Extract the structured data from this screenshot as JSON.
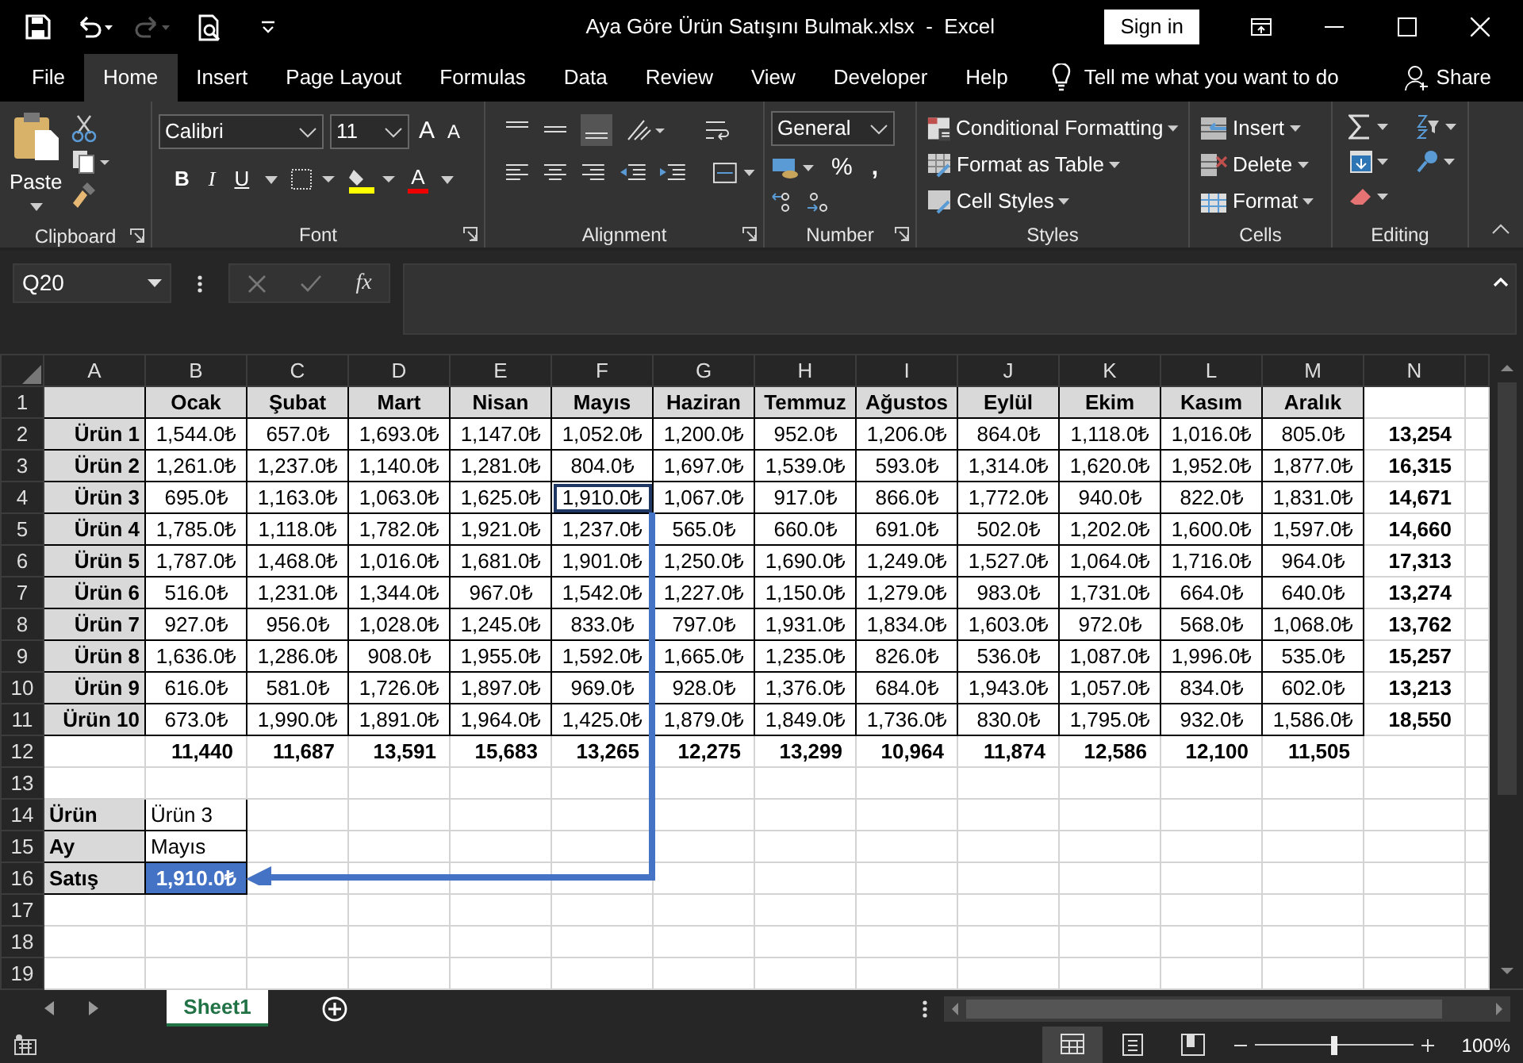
{
  "window": {
    "title": "Aya Göre Ürün Satışını Bulmak.xlsx  -  Excel",
    "sign_in": "Sign in"
  },
  "menu": [
    {
      "label": "File",
      "selected": false
    },
    {
      "label": "Home",
      "selected": true
    },
    {
      "label": "Insert",
      "selected": false
    },
    {
      "label": "Page Layout",
      "selected": false
    },
    {
      "label": "Formulas",
      "selected": false
    },
    {
      "label": "Data",
      "selected": false
    },
    {
      "label": "Review",
      "selected": false
    },
    {
      "label": "View",
      "selected": false
    },
    {
      "label": "Developer",
      "selected": false
    },
    {
      "label": "Help",
      "selected": false
    }
  ],
  "tell_me": "Tell me what you want to do",
  "share": "Share",
  "ribbon": {
    "clipboard": {
      "paste": "Paste",
      "label": "Clipboard"
    },
    "font": {
      "name": "Calibri",
      "size": "11",
      "grow": "A",
      "shrink": "A",
      "bold": "B",
      "italic": "I",
      "underline": "U",
      "font_color": "A",
      "label": "Font"
    },
    "alignment": {
      "label": "Alignment"
    },
    "number": {
      "format": "General",
      "percent": "%",
      "comma": ",",
      "label": "Number"
    },
    "styles": {
      "buttons": [
        "Conditional Formatting",
        "Format as Table",
        "Cell Styles"
      ],
      "label": "Styles"
    },
    "cells": {
      "buttons": [
        "Insert",
        "Delete",
        "Format"
      ],
      "label": "Cells"
    },
    "editing": {
      "label": "Editing"
    }
  },
  "name_box": "Q20",
  "formula_label": "fx",
  "sheet": {
    "columns": [
      "A",
      "B",
      "C",
      "D",
      "E",
      "F",
      "G",
      "H",
      "I",
      "J",
      "K",
      "L",
      "M",
      "N"
    ],
    "rows": [
      {
        "number": "1",
        "cells": [
          {
            "kind": "grey"
          },
          {
            "kind": "month",
            "text": "Ocak"
          },
          {
            "kind": "month",
            "text": "Şubat"
          },
          {
            "kind": "month",
            "text": "Mart"
          },
          {
            "kind": "month",
            "text": "Nisan"
          },
          {
            "kind": "month",
            "text": "Mayıs"
          },
          {
            "kind": "month",
            "text": "Haziran"
          },
          {
            "kind": "month",
            "text": "Temmuz"
          },
          {
            "kind": "month",
            "text": "Ağustos"
          },
          {
            "kind": "month",
            "text": "Eylül"
          },
          {
            "kind": "month",
            "text": "Ekim"
          },
          {
            "kind": "month",
            "text": "Kasım"
          },
          {
            "kind": "month",
            "text": "Aralık"
          }
        ]
      },
      {
        "number": "2",
        "cells": [
          {
            "kind": "product",
            "text": "Ürün 1"
          },
          {
            "kind": "amount",
            "text": "1,544.0₺"
          },
          {
            "kind": "amount",
            "text": "657.0₺"
          },
          {
            "kind": "amount",
            "text": "1,693.0₺"
          },
          {
            "kind": "amount",
            "text": "1,147.0₺"
          },
          {
            "kind": "amount",
            "text": "1,052.0₺"
          },
          {
            "kind": "amount",
            "text": "1,200.0₺"
          },
          {
            "kind": "amount",
            "text": "952.0₺"
          },
          {
            "kind": "amount",
            "text": "1,206.0₺"
          },
          {
            "kind": "amount",
            "text": "864.0₺"
          },
          {
            "kind": "amount",
            "text": "1,118.0₺"
          },
          {
            "kind": "amount",
            "text": "1,016.0₺"
          },
          {
            "kind": "amount",
            "text": "805.0₺"
          },
          {
            "kind": "total",
            "text": "13,254"
          }
        ]
      },
      {
        "number": "3",
        "cells": [
          {
            "kind": "product",
            "text": "Ürün 2"
          },
          {
            "kind": "amount",
            "text": "1,261.0₺"
          },
          {
            "kind": "amount",
            "text": "1,237.0₺"
          },
          {
            "kind": "amount",
            "text": "1,140.0₺"
          },
          {
            "kind": "amount",
            "text": "1,281.0₺"
          },
          {
            "kind": "amount",
            "text": "804.0₺"
          },
          {
            "kind": "amount",
            "text": "1,697.0₺"
          },
          {
            "kind": "amount",
            "text": "1,539.0₺"
          },
          {
            "kind": "amount",
            "text": "593.0₺"
          },
          {
            "kind": "amount",
            "text": "1,314.0₺"
          },
          {
            "kind": "amount",
            "text": "1,620.0₺"
          },
          {
            "kind": "amount",
            "text": "1,952.0₺"
          },
          {
            "kind": "amount",
            "text": "1,877.0₺"
          },
          {
            "kind": "total",
            "text": "16,315"
          }
        ]
      },
      {
        "number": "4",
        "cells": [
          {
            "kind": "product",
            "text": "Ürün 3"
          },
          {
            "kind": "amount",
            "text": "695.0₺"
          },
          {
            "kind": "amount",
            "text": "1,163.0₺"
          },
          {
            "kind": "amount",
            "text": "1,063.0₺"
          },
          {
            "kind": "amount",
            "text": "1,625.0₺"
          },
          {
            "kind": "highlight",
            "text": "1,910.0₺"
          },
          {
            "kind": "amount",
            "text": "1,067.0₺"
          },
          {
            "kind": "amount",
            "text": "917.0₺"
          },
          {
            "kind": "amount",
            "text": "866.0₺"
          },
          {
            "kind": "amount",
            "text": "1,772.0₺"
          },
          {
            "kind": "amount",
            "text": "940.0₺"
          },
          {
            "kind": "amount",
            "text": "822.0₺"
          },
          {
            "kind": "amount",
            "text": "1,831.0₺"
          },
          {
            "kind": "total",
            "text": "14,671"
          }
        ]
      },
      {
        "number": "5",
        "cells": [
          {
            "kind": "product",
            "text": "Ürün 4"
          },
          {
            "kind": "amount",
            "text": "1,785.0₺"
          },
          {
            "kind": "amount",
            "text": "1,118.0₺"
          },
          {
            "kind": "amount",
            "text": "1,782.0₺"
          },
          {
            "kind": "amount",
            "text": "1,921.0₺"
          },
          {
            "kind": "amount",
            "text": "1,237.0₺"
          },
          {
            "kind": "amount",
            "text": "565.0₺"
          },
          {
            "kind": "amount",
            "text": "660.0₺"
          },
          {
            "kind": "amount",
            "text": "691.0₺"
          },
          {
            "kind": "amount",
            "text": "502.0₺"
          },
          {
            "kind": "amount",
            "text": "1,202.0₺"
          },
          {
            "kind": "amount",
            "text": "1,600.0₺"
          },
          {
            "kind": "amount",
            "text": "1,597.0₺"
          },
          {
            "kind": "total",
            "text": "14,660"
          }
        ]
      },
      {
        "number": "6",
        "cells": [
          {
            "kind": "product",
            "text": "Ürün 5"
          },
          {
            "kind": "amount",
            "text": "1,787.0₺"
          },
          {
            "kind": "amount",
            "text": "1,468.0₺"
          },
          {
            "kind": "amount",
            "text": "1,016.0₺"
          },
          {
            "kind": "amount",
            "text": "1,681.0₺"
          },
          {
            "kind": "amount",
            "text": "1,901.0₺"
          },
          {
            "kind": "amount",
            "text": "1,250.0₺"
          },
          {
            "kind": "amount",
            "text": "1,690.0₺"
          },
          {
            "kind": "amount",
            "text": "1,249.0₺"
          },
          {
            "kind": "amount",
            "text": "1,527.0₺"
          },
          {
            "kind": "amount",
            "text": "1,064.0₺"
          },
          {
            "kind": "amount",
            "text": "1,716.0₺"
          },
          {
            "kind": "amount",
            "text": "964.0₺"
          },
          {
            "kind": "total",
            "text": "17,313"
          }
        ]
      },
      {
        "number": "7",
        "cells": [
          {
            "kind": "product",
            "text": "Ürün 6"
          },
          {
            "kind": "amount",
            "text": "516.0₺"
          },
          {
            "kind": "amount",
            "text": "1,231.0₺"
          },
          {
            "kind": "amount",
            "text": "1,344.0₺"
          },
          {
            "kind": "amount",
            "text": "967.0₺"
          },
          {
            "kind": "amount",
            "text": "1,542.0₺"
          },
          {
            "kind": "amount",
            "text": "1,227.0₺"
          },
          {
            "kind": "amount",
            "text": "1,150.0₺"
          },
          {
            "kind": "amount",
            "text": "1,279.0₺"
          },
          {
            "kind": "amount",
            "text": "983.0₺"
          },
          {
            "kind": "amount",
            "text": "1,731.0₺"
          },
          {
            "kind": "amount",
            "text": "664.0₺"
          },
          {
            "kind": "amount",
            "text": "640.0₺"
          },
          {
            "kind": "total",
            "text": "13,274"
          }
        ]
      },
      {
        "number": "8",
        "cells": [
          {
            "kind": "product",
            "text": "Ürün 7"
          },
          {
            "kind": "amount",
            "text": "927.0₺"
          },
          {
            "kind": "amount",
            "text": "956.0₺"
          },
          {
            "kind": "amount",
            "text": "1,028.0₺"
          },
          {
            "kind": "amount",
            "text": "1,245.0₺"
          },
          {
            "kind": "amount",
            "text": "833.0₺"
          },
          {
            "kind": "amount",
            "text": "797.0₺"
          },
          {
            "kind": "amount",
            "text": "1,931.0₺"
          },
          {
            "kind": "amount",
            "text": "1,834.0₺"
          },
          {
            "kind": "amount",
            "text": "1,603.0₺"
          },
          {
            "kind": "amount",
            "text": "972.0₺"
          },
          {
            "kind": "amount",
            "text": "568.0₺"
          },
          {
            "kind": "amount",
            "text": "1,068.0₺"
          },
          {
            "kind": "total",
            "text": "13,762"
          }
        ]
      },
      {
        "number": "9",
        "cells": [
          {
            "kind": "product",
            "text": "Ürün 8"
          },
          {
            "kind": "amount",
            "text": "1,636.0₺"
          },
          {
            "kind": "amount",
            "text": "1,286.0₺"
          },
          {
            "kind": "amount",
            "text": "908.0₺"
          },
          {
            "kind": "amount",
            "text": "1,955.0₺"
          },
          {
            "kind": "amount",
            "text": "1,592.0₺"
          },
          {
            "kind": "amount",
            "text": "1,665.0₺"
          },
          {
            "kind": "amount",
            "text": "1,235.0₺"
          },
          {
            "kind": "amount",
            "text": "826.0₺"
          },
          {
            "kind": "amount",
            "text": "536.0₺"
          },
          {
            "kind": "amount",
            "text": "1,087.0₺"
          },
          {
            "kind": "amount",
            "text": "1,996.0₺"
          },
          {
            "kind": "amount",
            "text": "535.0₺"
          },
          {
            "kind": "total",
            "text": "15,257"
          }
        ]
      },
      {
        "number": "10",
        "cells": [
          {
            "kind": "product",
            "text": "Ürün 9"
          },
          {
            "kind": "amount",
            "text": "616.0₺"
          },
          {
            "kind": "amount",
            "text": "581.0₺"
          },
          {
            "kind": "amount",
            "text": "1,726.0₺"
          },
          {
            "kind": "amount",
            "text": "1,897.0₺"
          },
          {
            "kind": "amount",
            "text": "969.0₺"
          },
          {
            "kind": "amount",
            "text": "928.0₺"
          },
          {
            "kind": "amount",
            "text": "1,376.0₺"
          },
          {
            "kind": "amount",
            "text": "684.0₺"
          },
          {
            "kind": "amount",
            "text": "1,943.0₺"
          },
          {
            "kind": "amount",
            "text": "1,057.0₺"
          },
          {
            "kind": "amount",
            "text": "834.0₺"
          },
          {
            "kind": "amount",
            "text": "602.0₺"
          },
          {
            "kind": "total",
            "text": "13,213"
          }
        ]
      },
      {
        "number": "11",
        "cells": [
          {
            "kind": "product",
            "text": "Ürün 10"
          },
          {
            "kind": "amount",
            "text": "673.0₺"
          },
          {
            "kind": "amount",
            "text": "1,990.0₺"
          },
          {
            "kind": "amount",
            "text": "1,891.0₺"
          },
          {
            "kind": "amount",
            "text": "1,964.0₺"
          },
          {
            "kind": "amount",
            "text": "1,425.0₺"
          },
          {
            "kind": "amount",
            "text": "1,879.0₺"
          },
          {
            "kind": "amount",
            "text": "1,849.0₺"
          },
          {
            "kind": "amount",
            "text": "1,736.0₺"
          },
          {
            "kind": "amount",
            "text": "830.0₺"
          },
          {
            "kind": "amount",
            "text": "1,795.0₺"
          },
          {
            "kind": "amount",
            "text": "932.0₺"
          },
          {
            "kind": "amount",
            "text": "1,586.0₺"
          },
          {
            "kind": "total",
            "text": "18,550"
          }
        ]
      },
      {
        "number": "12",
        "cells": [
          {
            "kind": "blank"
          },
          {
            "kind": "total",
            "text": "11,440"
          },
          {
            "kind": "total",
            "text": "11,687"
          },
          {
            "kind": "total",
            "text": "13,591"
          },
          {
            "kind": "total",
            "text": "15,683"
          },
          {
            "kind": "total",
            "text": "13,265"
          },
          {
            "kind": "total",
            "text": "12,275"
          },
          {
            "kind": "total",
            "text": "13,299"
          },
          {
            "kind": "total",
            "text": "10,964"
          },
          {
            "kind": "total",
            "text": "11,874"
          },
          {
            "kind": "total",
            "text": "12,586"
          },
          {
            "kind": "total",
            "text": "12,100"
          },
          {
            "kind": "total",
            "text": "11,505"
          }
        ]
      },
      {
        "number": "13"
      },
      {
        "number": "14",
        "cells": [
          {
            "kind": "field",
            "text": "Ürün"
          },
          {
            "kind": "input",
            "text": "Ürün 3"
          }
        ]
      },
      {
        "number": "15",
        "cells": [
          {
            "kind": "field",
            "text": "Ay"
          },
          {
            "kind": "input",
            "text": "Mayıs"
          }
        ]
      },
      {
        "number": "16",
        "cells": [
          {
            "kind": "field",
            "text": "Satış"
          },
          {
            "kind": "found",
            "text": "1,910.0₺"
          }
        ]
      },
      {
        "number": "17"
      },
      {
        "number": "18"
      },
      {
        "number": "19"
      }
    ]
  },
  "sheet_tabs": [
    {
      "label": "Sheet1",
      "selected": true
    }
  ],
  "views": [
    {
      "kind": "normal",
      "selected": true
    },
    {
      "kind": "page-layout",
      "selected": false
    },
    {
      "kind": "page-break",
      "selected": false
    }
  ],
  "zoom": {
    "level": 0.5,
    "reading": "100%"
  }
}
